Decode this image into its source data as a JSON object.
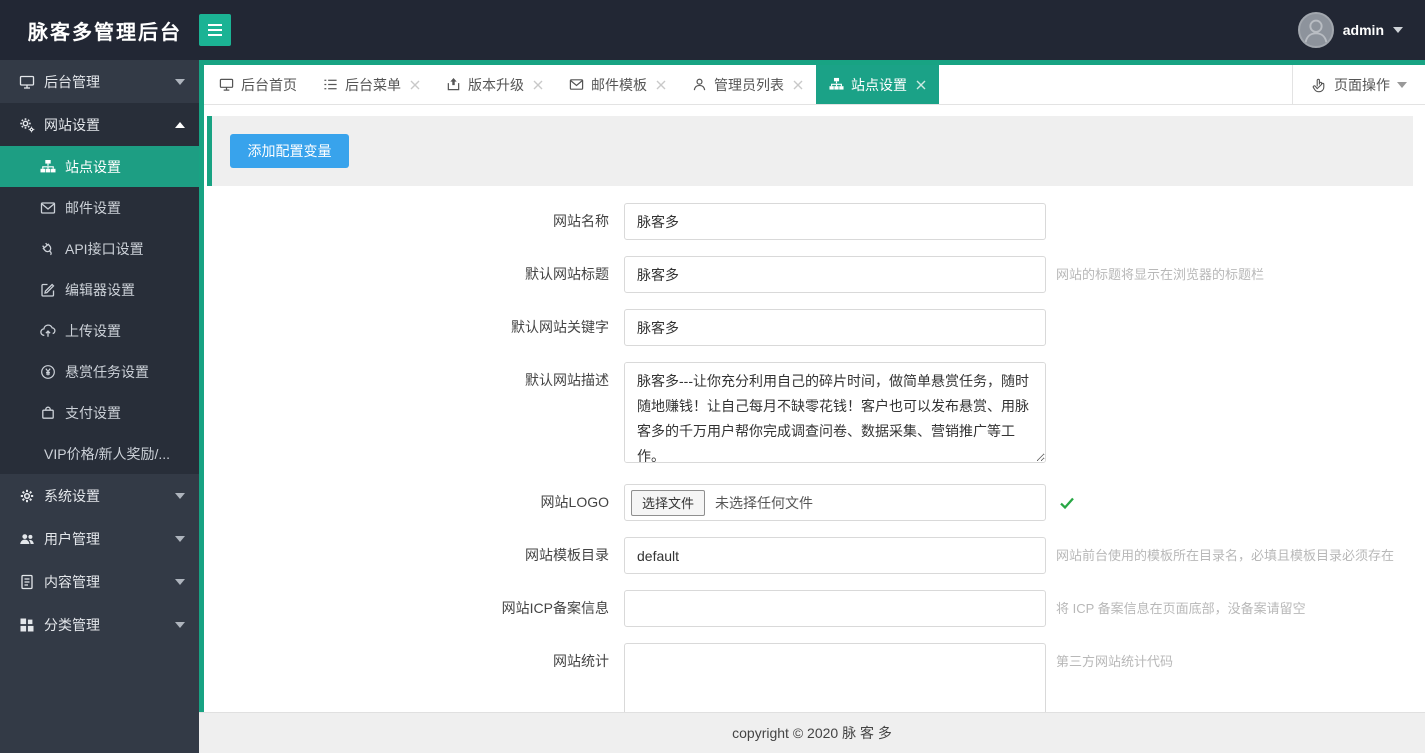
{
  "header": {
    "title": "脉客多管理后台",
    "user": "admin"
  },
  "sidebar": {
    "groups": [
      {
        "label": "后台管理",
        "icon": "monitor-icon",
        "state": "collapsed"
      },
      {
        "label": "网站设置",
        "icon": "gears-icon",
        "state": "expanded",
        "children": [
          {
            "label": "站点设置",
            "icon": "sitemap-icon",
            "active": true
          },
          {
            "label": "邮件设置",
            "icon": "envelope-icon",
            "active": false
          },
          {
            "label": "API接口设置",
            "icon": "plug-icon",
            "active": false
          },
          {
            "label": "编辑器设置",
            "icon": "edit-icon",
            "active": false
          },
          {
            "label": "上传设置",
            "icon": "cloud-upload-icon",
            "active": false
          },
          {
            "label": "悬赏任务设置",
            "icon": "yen-icon",
            "active": false
          },
          {
            "label": "支付设置",
            "icon": "bag-icon",
            "active": false
          },
          {
            "label": "VIP价格/新人奖励/...",
            "icon": null,
            "active": false
          }
        ]
      },
      {
        "label": "系统设置",
        "icon": "gear-icon",
        "state": "collapsed"
      },
      {
        "label": "用户管理",
        "icon": "users-icon",
        "state": "collapsed"
      },
      {
        "label": "内容管理",
        "icon": "document-icon",
        "state": "collapsed"
      },
      {
        "label": "分类管理",
        "icon": "grid-icon",
        "state": "collapsed"
      }
    ]
  },
  "tabs": [
    {
      "label": "后台首页",
      "icon": "monitor-icon",
      "closable": false,
      "active": false
    },
    {
      "label": "后台菜单",
      "icon": "list-icon",
      "closable": true,
      "active": false
    },
    {
      "label": "版本升级",
      "icon": "upload-icon",
      "closable": true,
      "active": false
    },
    {
      "label": "邮件模板",
      "icon": "envelope-icon",
      "closable": true,
      "active": false
    },
    {
      "label": "管理员列表",
      "icon": "user-icon",
      "closable": true,
      "active": false
    },
    {
      "label": "站点设置",
      "icon": "sitemap-icon",
      "closable": true,
      "active": true
    }
  ],
  "page_actions": {
    "label": "页面操作"
  },
  "toolbar": {
    "add_button": "添加配置变量"
  },
  "form": {
    "fields": [
      {
        "label": "网站名称",
        "type": "input",
        "value": "脉客多",
        "hint": ""
      },
      {
        "label": "默认网站标题",
        "type": "input",
        "value": "脉客多",
        "hint": "网站的标题将显示在浏览器的标题栏"
      },
      {
        "label": "默认网站关键字",
        "type": "input",
        "value": "脉客多",
        "hint": ""
      },
      {
        "label": "默认网站描述",
        "type": "textarea",
        "value": "脉客多---让你充分利用自己的碎片时间，做简单悬赏任务，随时随地赚钱！让自己每月不缺零花钱！客户也可以发布悬赏、用脉客多的千万用户帮你完成调查问卷、数据采集、营销推广等工作。",
        "hint": ""
      },
      {
        "label": "网站LOGO",
        "type": "file",
        "button_label": "选择文件",
        "no_file_text": "未选择任何文件",
        "status": "valid"
      },
      {
        "label": "网站模板目录",
        "type": "input",
        "value": "default",
        "hint": "网站前台使用的模板所在目录名，必填且模板目录必须存在"
      },
      {
        "label": "网站ICP备案信息",
        "type": "input",
        "value": "",
        "hint": "将 ICP 备案信息在页面底部，没备案请留空"
      },
      {
        "label": "网站统计",
        "type": "textarea",
        "value": "",
        "hint": "第三方网站统计代码"
      }
    ]
  },
  "footer": {
    "copyright": "copyright © 2020 脉 客 多"
  },
  "colors": {
    "accent_teal": "#18a383",
    "active_item_teal": "#1d9e83",
    "active_tab_teal": "#1ba287",
    "hamburger_teal": "#1bb394",
    "button_blue": "#38a3ec",
    "check_green": "#28a745",
    "header_bg": "#222734",
    "sidebar_bg": "#333a46",
    "sidebar_open_bg": "#282e39",
    "band_bg": "#efefef",
    "footer_bg": "#efefef"
  }
}
